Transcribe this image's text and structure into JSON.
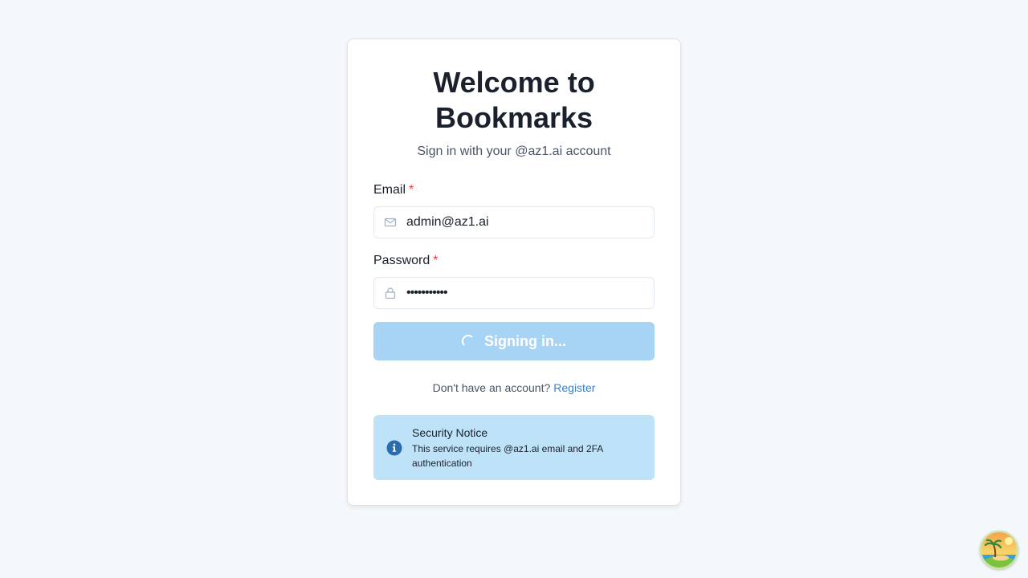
{
  "login": {
    "title": "Welcome to Bookmarks",
    "subtitle": "Sign in with your @az1.ai account",
    "email_label": "Email",
    "email_value": "admin@az1.ai",
    "password_label": "Password",
    "password_value": "•••••••••••",
    "required_mark": "*",
    "submit_label": "Signing in...",
    "register_prompt": "Don't have an account?",
    "register_link": "Register"
  },
  "notice": {
    "title": "Security Notice",
    "body": "This service requires @az1.ai email and 2FA authentication"
  },
  "icons": {
    "email": "mail-icon",
    "password": "lock-icon",
    "notice": "info-icon",
    "spinner": "loading-spinner-icon",
    "corner": "palm-island-avatar"
  },
  "colors": {
    "accent": "#3182ce",
    "button_disabled": "#a7d3f5",
    "notice_bg": "#bee3f8",
    "required": "#e53e3e"
  }
}
